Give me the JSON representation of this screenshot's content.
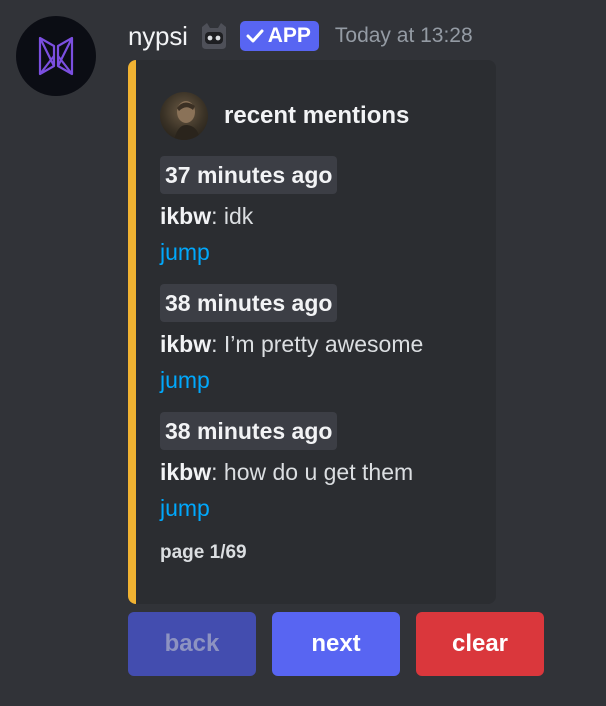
{
  "message": {
    "username": "nypsi",
    "app_tag": "APP",
    "timestamp": "Today at 13:28"
  },
  "embed": {
    "accent_color": "#f0b232",
    "author": "recent mentions",
    "mentions": [
      {
        "time": "37 minutes ago",
        "user": "ikbw",
        "text": ": idk",
        "link": "jump"
      },
      {
        "time": "38 minutes ago",
        "user": "ikbw",
        "text": ": I’m pretty awesome",
        "link": "jump"
      },
      {
        "time": "38 minutes ago",
        "user": "ikbw",
        "text": ": how do u get them",
        "link": "jump"
      }
    ],
    "footer": "page 1/69"
  },
  "buttons": {
    "back": "back",
    "next": "next",
    "clear": "clear"
  }
}
